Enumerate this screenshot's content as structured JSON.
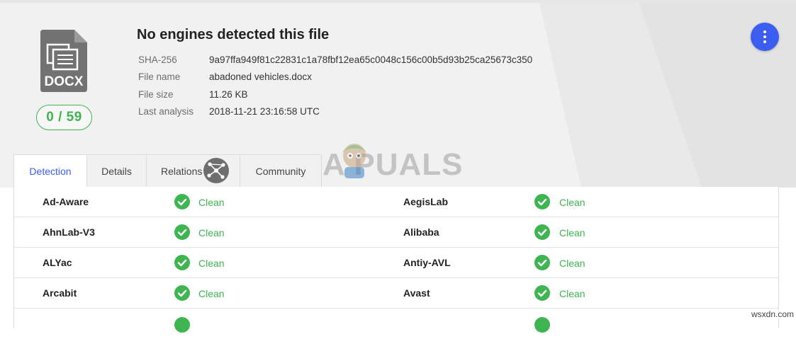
{
  "file": {
    "type_label": "DOCX",
    "score": "0 / 59",
    "title": "No engines detected this file",
    "details": [
      {
        "label": "SHA-256",
        "value": "9a97ffa949f81c22831c1a78fbf12ea65c0048c156c00b5d93b25ca25673c350"
      },
      {
        "label": "File name",
        "value": "abadoned vehicles.docx"
      },
      {
        "label": "File size",
        "value": "11.26 KB"
      },
      {
        "label": "Last analysis",
        "value": "2018-11-21 23:16:58 UTC"
      }
    ]
  },
  "tabs": [
    {
      "label": "Detection",
      "active": true
    },
    {
      "label": "Details",
      "active": false
    },
    {
      "label": "Relations",
      "active": false
    },
    {
      "label": "Community",
      "active": false
    }
  ],
  "results": [
    {
      "left": {
        "engine": "Ad-Aware",
        "status": "Clean"
      },
      "right": {
        "engine": "AegisLab",
        "status": "Clean"
      }
    },
    {
      "left": {
        "engine": "AhnLab-V3",
        "status": "Clean"
      },
      "right": {
        "engine": "Alibaba",
        "status": "Clean"
      }
    },
    {
      "left": {
        "engine": "ALYac",
        "status": "Clean"
      },
      "right": {
        "engine": "Antiy-AVL",
        "status": "Clean"
      }
    },
    {
      "left": {
        "engine": "Arcabit",
        "status": "Clean"
      },
      "right": {
        "engine": "Avast",
        "status": "Clean"
      }
    }
  ],
  "watermark": "A PUALS",
  "site_mark": "wsxdn.com",
  "colors": {
    "accent": "#3b5ef0",
    "clean": "#3eb551"
  },
  "icons": {
    "menu": "more-vert-icon",
    "relations": "graph-network-icon",
    "check": "check-circle-icon",
    "file": "docx-file-icon"
  }
}
